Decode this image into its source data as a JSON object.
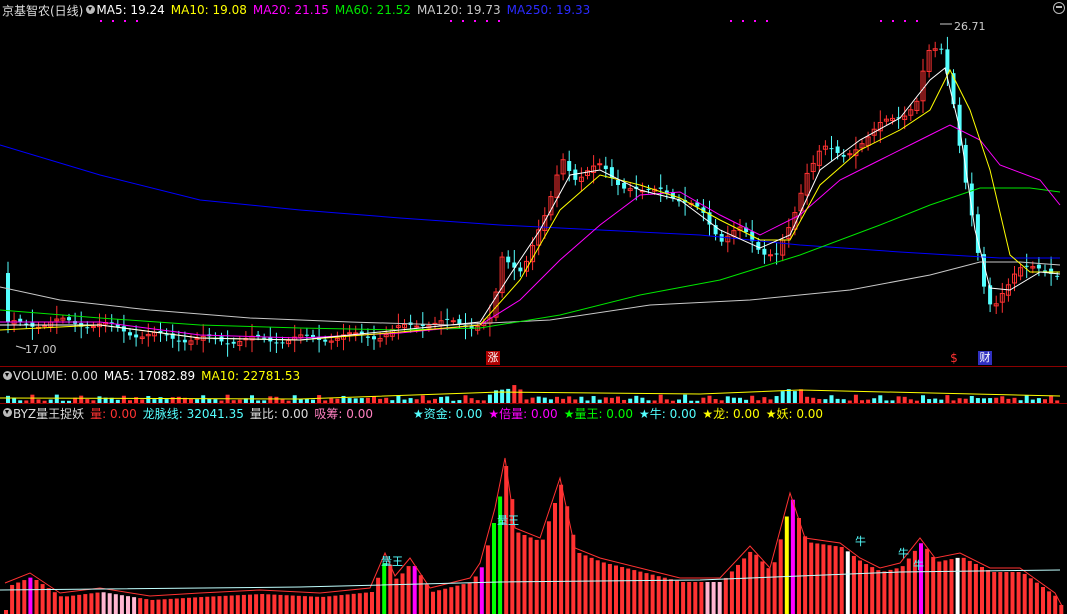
{
  "main_legend": {
    "title": "京基智农(日线)",
    "ma5": "MA5: 19.24",
    "ma10": "MA10: 19.08",
    "ma20": "MA20: 21.15",
    "ma60": "MA60: 21.52",
    "ma120": "MA120: 19.73",
    "ma250": "MA250: 19.33"
  },
  "price_labels": {
    "high": "26.71",
    "low": "17.00"
  },
  "markers": {
    "zhang": "涨",
    "dollar": "$",
    "cai": "财"
  },
  "volume_legend": {
    "title": "VOLUME: 0.00",
    "ma5": "MA5: 17082.89",
    "ma10": "MA10: 22781.53"
  },
  "indicator_legend": {
    "title": "BYZ量王捉妖",
    "liang": "量: 0.00",
    "longmai": "龙脉线: 32041.35",
    "liangbi": "量比: 0.00",
    "xichou": "吸筹: 0.00",
    "zijin": "★资金: 0.00",
    "beiliang": "★倍量: 0.00",
    "liangwang": "★量王: 0.00",
    "niu": "★牛: 0.00",
    "long": "★龙: 0.00",
    "yao": "★妖: 0.00"
  },
  "indicator_labels": {
    "liangwang1": "量王",
    "liangwang2": "量王",
    "niu1": "牛",
    "niu2": "牛",
    "niu3": "牛"
  },
  "colors": {
    "up": "#ff3232",
    "down": "#54ffff",
    "ma5": "#ffffff",
    "ma10": "#ffff00",
    "ma20": "#ff00ff",
    "ma60": "#00e600",
    "ma120": "#c8c8c8",
    "ma250": "#0000ff",
    "separator": "#8b0000"
  },
  "chart_data": {
    "type": "candlestick",
    "price_range": [
      17.0,
      26.71
    ],
    "ma_series": [
      "MA5",
      "MA10",
      "MA20",
      "MA60",
      "MA120",
      "MA250"
    ],
    "volume_pane": true,
    "indicator_pane": "BYZ量王捉妖"
  }
}
